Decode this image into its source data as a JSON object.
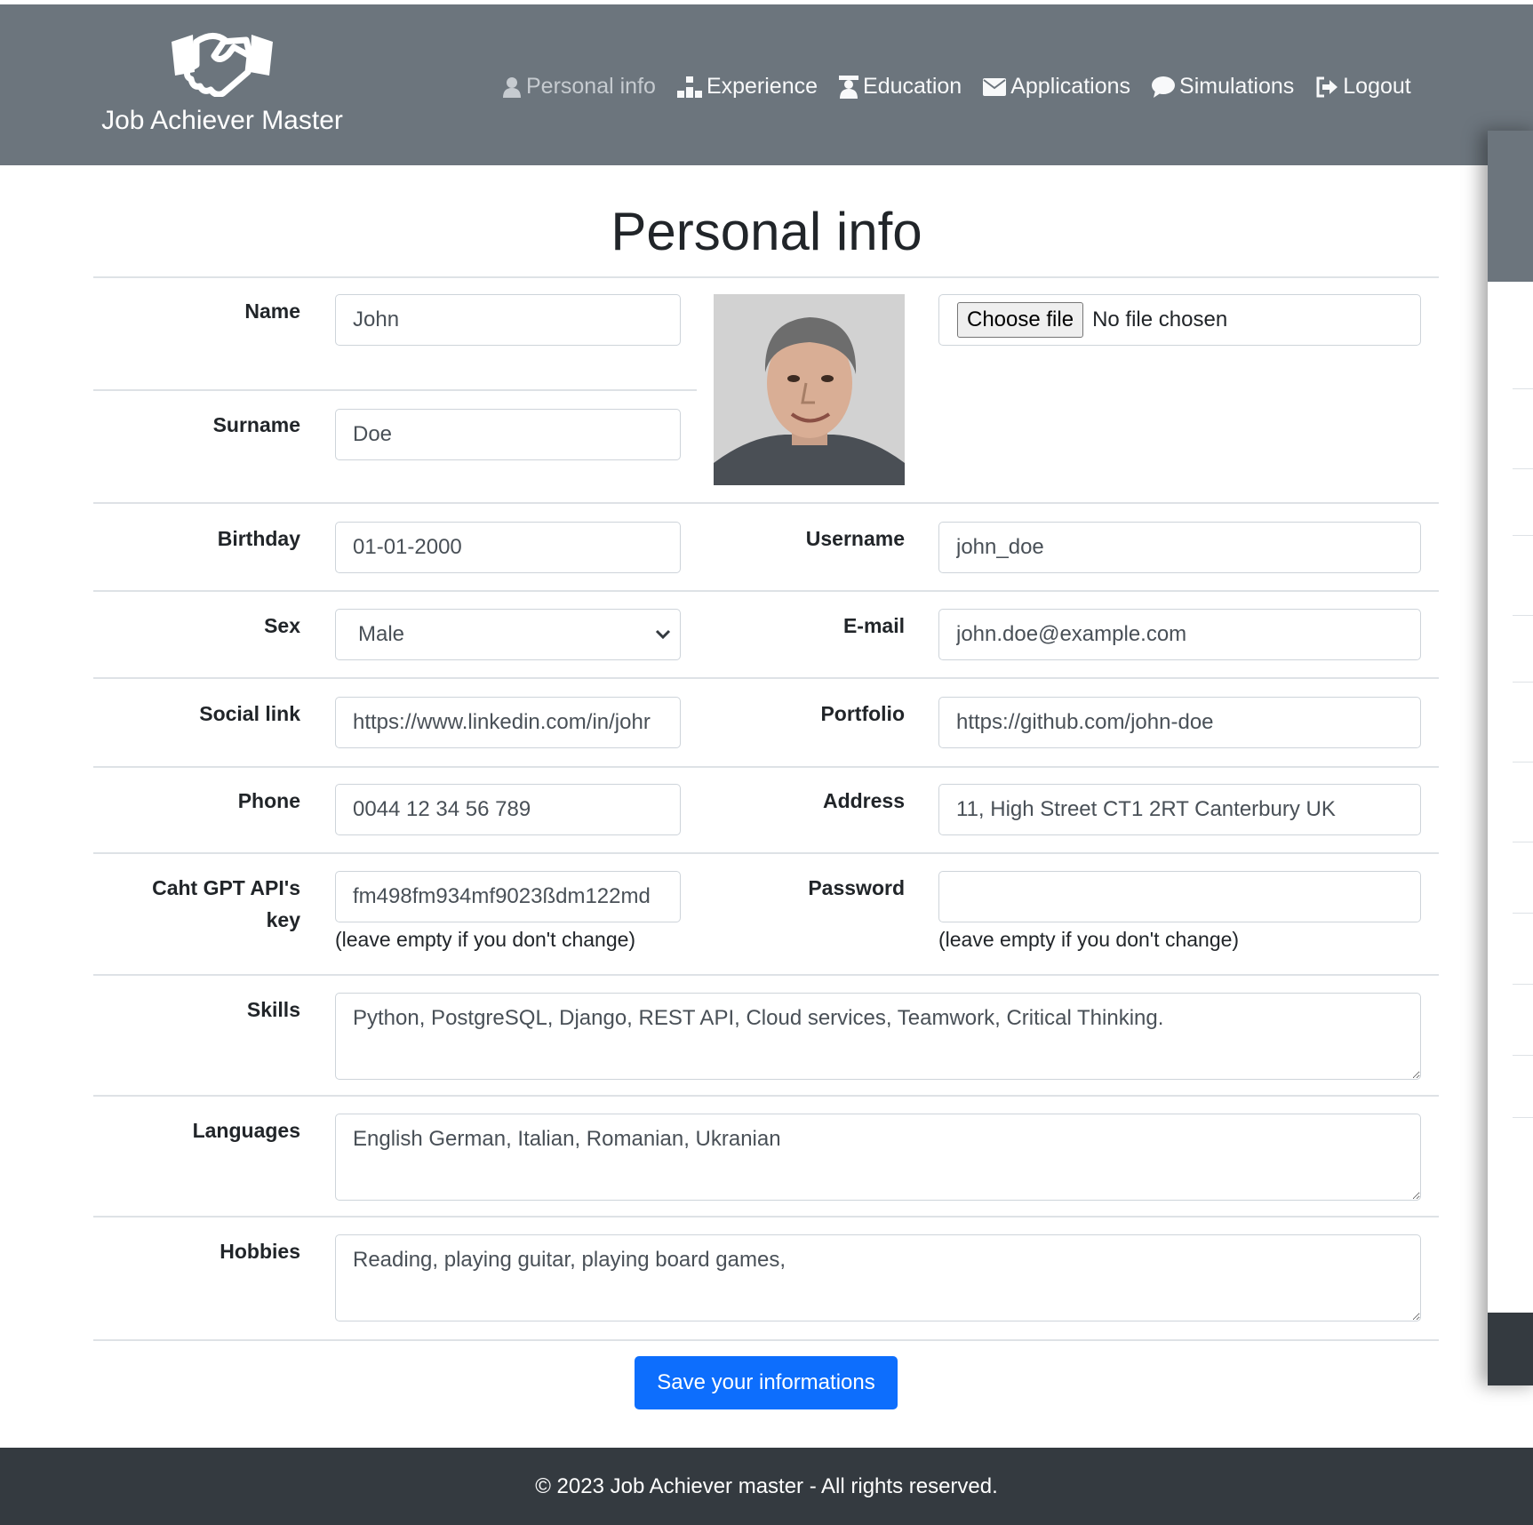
{
  "app": {
    "brand": "Job Achiever Master",
    "logo_icon": "handshake-icon"
  },
  "nav": {
    "personal": {
      "label": "Personal info",
      "icon": "user-icon"
    },
    "experience": {
      "label": "Experience",
      "icon": "sitemap-icon"
    },
    "education": {
      "label": "Education",
      "icon": "graduate-icon"
    },
    "applications": {
      "label": "Applications",
      "icon": "envelope-icon"
    },
    "simulations": {
      "label": "Simulations",
      "icon": "chat-bubble-icon"
    },
    "logout": {
      "label": "Logout",
      "icon": "logout-icon"
    }
  },
  "page": {
    "title": "Personal info"
  },
  "form": {
    "name": {
      "label": "Name",
      "value": "John"
    },
    "surname": {
      "label": "Surname",
      "value": "Doe"
    },
    "photo_upload": {
      "button": "Choose file",
      "status": "No file chosen"
    },
    "birthday": {
      "label": "Birthday",
      "value": "01-01-2000"
    },
    "username": {
      "label": "Username",
      "value": "john_doe"
    },
    "sex": {
      "label": "Sex",
      "value": "Male"
    },
    "email": {
      "label": "E-mail",
      "value": "john.doe@example.com"
    },
    "social": {
      "label": "Social link",
      "value": "https://www.linkedin.com/in/johr"
    },
    "portfolio": {
      "label": "Portfolio",
      "value": "https://github.com/john-doe"
    },
    "phone": {
      "label": "Phone",
      "value": "0044 12 34 56 789"
    },
    "address": {
      "label": "Address",
      "value": "11, High Street CT1 2RT Canterbury UK"
    },
    "api_key": {
      "label_line1": "Caht GPT API's",
      "label_line2": "key",
      "value": "fm498fm934mf9023ßdm122md",
      "hint": "(leave empty if you don't change)"
    },
    "password": {
      "label": "Password",
      "value": "",
      "hint": "(leave empty if you don't change)"
    },
    "skills": {
      "label": "Skills",
      "value": "Python, PostgreSQL, Django, REST API, Cloud services, Teamwork, Critical Thinking."
    },
    "languages": {
      "label": "Languages",
      "value": "English German, Italian, Romanian, Ukranian"
    },
    "hobbies": {
      "label": "Hobbies",
      "value": "Reading, playing guitar, playing board games,"
    },
    "save": "Save your informations"
  },
  "footer": {
    "text": "© 2023 Job Achiever master - All rights reserved."
  },
  "colors": {
    "header_bg": "#6c757d",
    "footer_bg": "#343a40",
    "primary": "#0d6efd"
  }
}
